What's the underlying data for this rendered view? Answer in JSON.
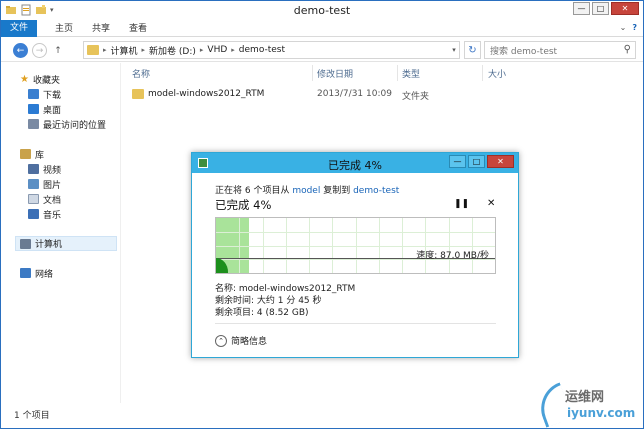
{
  "window": {
    "title": "demo-test",
    "min_glyph": "—",
    "max_glyph": "□",
    "close_glyph": "✕"
  },
  "ribbon": {
    "tabs": [
      "文件",
      "主页",
      "共享",
      "查看"
    ]
  },
  "address": {
    "crumbs": [
      "计算机",
      "新加卷 (D:)",
      "VHD",
      "demo-test"
    ],
    "search_placeholder": "搜索 demo-test"
  },
  "sidebar": {
    "favorites": "收藏夹",
    "fav_items": [
      "下载",
      "桌面",
      "最近访问的位置"
    ],
    "libraries": "库",
    "lib_items": [
      "视频",
      "图片",
      "文档",
      "音乐"
    ],
    "computer": "计算机",
    "network": "网络"
  },
  "filelist": {
    "columns": [
      "名称",
      "修改日期",
      "类型",
      "大小"
    ],
    "rows": [
      {
        "name": "model-windows2012_RTM",
        "date": "2013/7/31 10:09",
        "type": "文件夹",
        "size": ""
      }
    ]
  },
  "statusbar": {
    "text": "1 个项目"
  },
  "dialog": {
    "title": "已完成 4%",
    "line_prefix": "正在将 6 个项目从 ",
    "source": "model",
    "line_mid": " 复制到 ",
    "dest": "demo-test",
    "percent_text": "已完成 4%",
    "progress_fraction": 0.04,
    "speed": "速度: 87.0 MB/秒",
    "name_line": "名称: model-windows2012_RTM",
    "time_line": "剩余时间: 大约 1 分 45 秒",
    "items_line": "剩余项目: 4 (8.52 GB)",
    "toggle": "简略信息",
    "pause_glyph": "❚❚",
    "cancel_glyph": "✕"
  },
  "watermark": {
    "line1": "运维网",
    "line2": "iyunv.com"
  },
  "colors": {
    "accent": "#1979ca",
    "dialog_title": "#39b1e4",
    "progress": "#a9e39a",
    "close": "#c7453c"
  }
}
